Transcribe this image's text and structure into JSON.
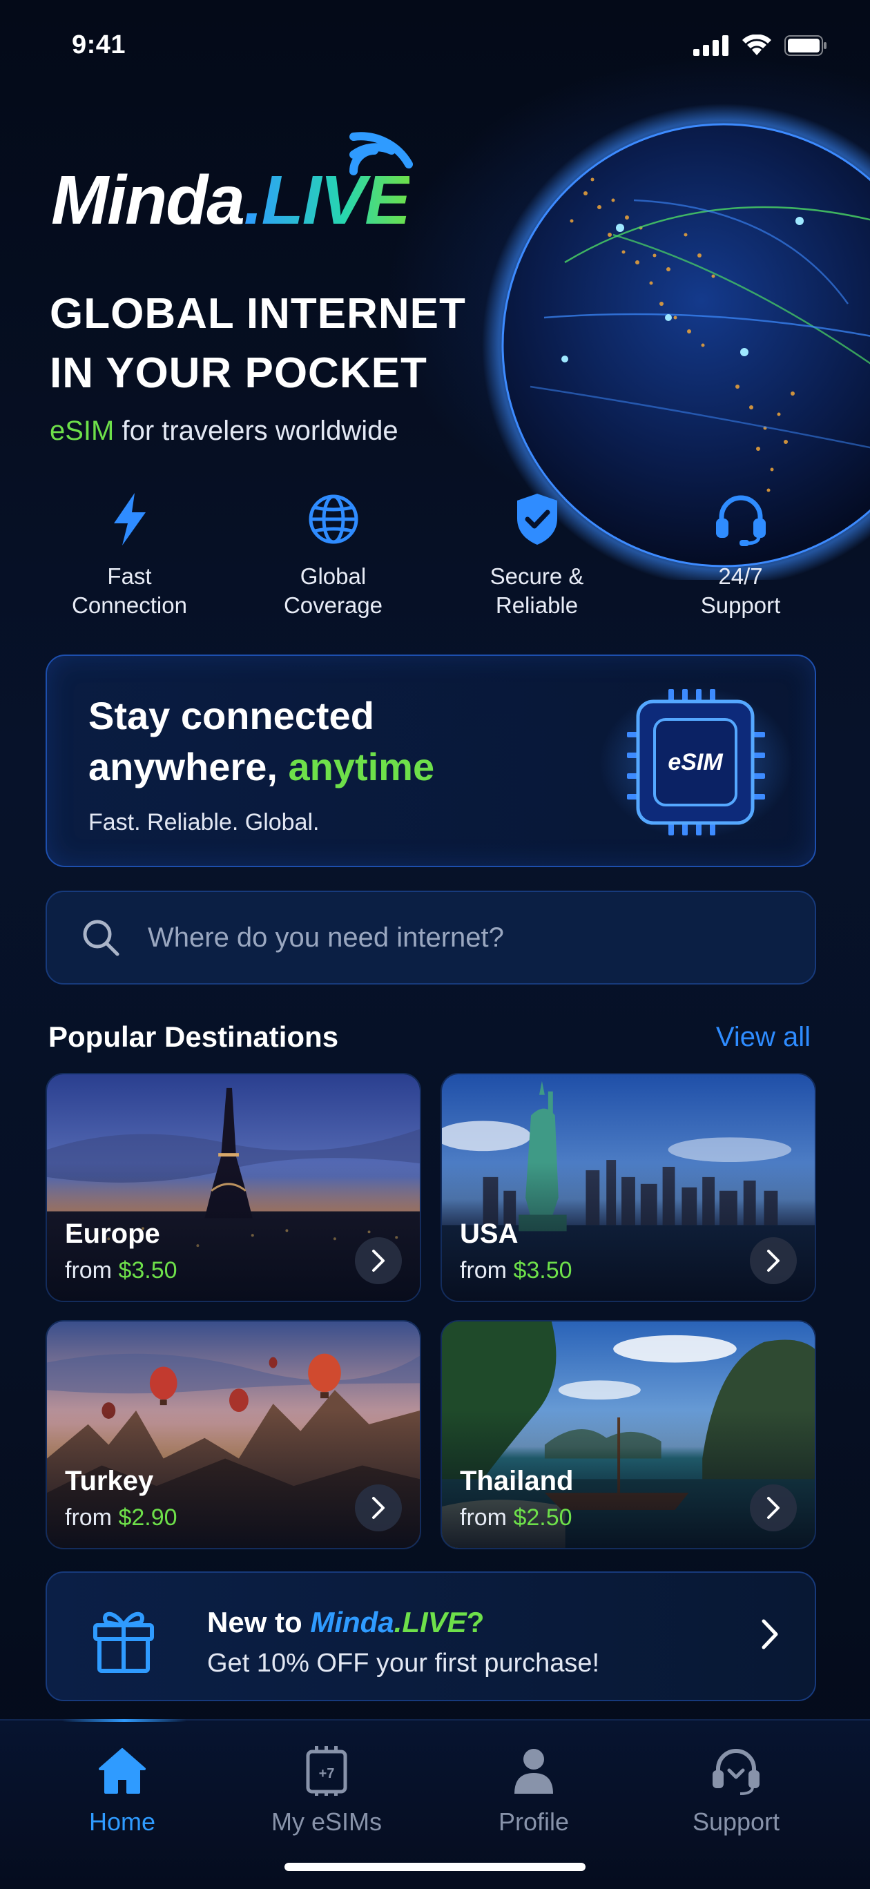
{
  "status_bar": {
    "time": "9:41"
  },
  "brand": {
    "name_part1": "Minda",
    "name_part2": ".LIVE"
  },
  "hero": {
    "title_line1": "GLOBAL INTERNET",
    "title_line2": "IN YOUR POCKET",
    "subtitle_highlight": "eSIM",
    "subtitle_rest": " for travelers worldwide"
  },
  "features": [
    {
      "label": "Fast\nConnection",
      "icon": "lightning-icon"
    },
    {
      "label": "Global\nCoverage",
      "icon": "globe-icon"
    },
    {
      "label": "Secure &\nReliable",
      "icon": "shield-check-icon"
    },
    {
      "label": "24/7\nSupport",
      "icon": "headset-icon"
    }
  ],
  "promo": {
    "title_line1": "Stay connected",
    "title_line2_prefix": "anywhere, ",
    "title_line2_highlight": "anytime",
    "subtitle": "Fast. Reliable. Global.",
    "chip_label": "eSIM"
  },
  "search": {
    "placeholder": "Where do you need internet?"
  },
  "popular": {
    "title": "Popular Destinations",
    "view_all": "View all",
    "destinations": [
      {
        "name": "Europe",
        "from_label": "from ",
        "price": "$3.50"
      },
      {
        "name": "USA",
        "from_label": "from ",
        "price": "$3.50"
      },
      {
        "name": "Turkey",
        "from_label": "from ",
        "price": "$2.90"
      },
      {
        "name": "Thailand",
        "from_label": "from ",
        "price": "$2.50"
      }
    ]
  },
  "offer": {
    "title_prefix": "New to ",
    "brand_part1": "Minda",
    "brand_part2": ".LIVE",
    "title_suffix": "?",
    "subtitle": "Get 10% OFF your first purchase!"
  },
  "tabbar": {
    "tabs": [
      {
        "label": "Home",
        "icon": "home-icon",
        "active": true
      },
      {
        "label": "My eSIMs",
        "icon": "esim-card-icon",
        "active": false
      },
      {
        "label": "Profile",
        "icon": "person-icon",
        "active": false
      },
      {
        "label": "Support",
        "icon": "support-headset-icon",
        "active": false
      }
    ]
  },
  "colors": {
    "accent_blue": "#2f9bff",
    "accent_green": "#6ee04a",
    "background": "#050b1a"
  }
}
